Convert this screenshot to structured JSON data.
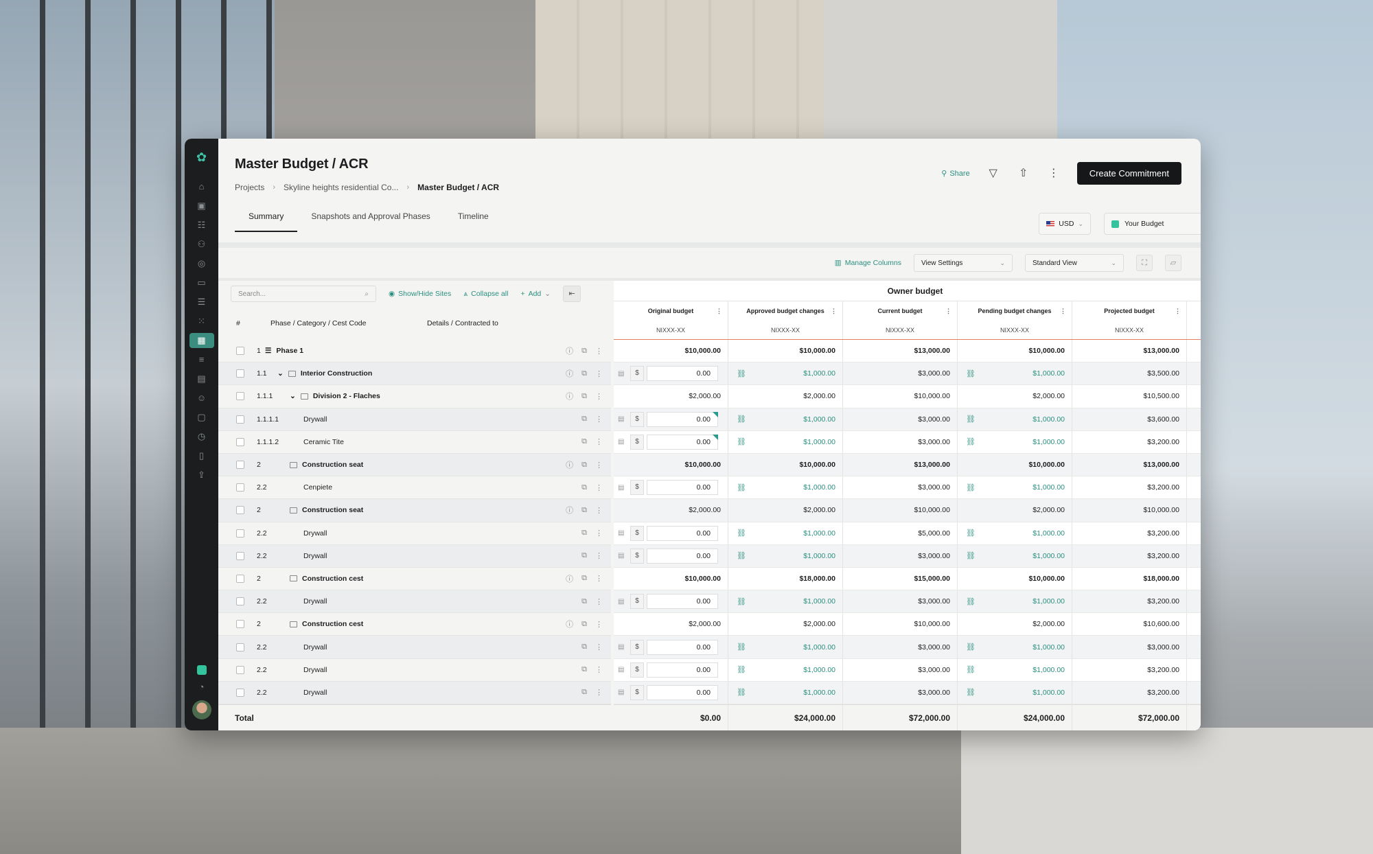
{
  "page_title": "Master Budget / ACR",
  "breadcrumb": [
    "Projects",
    "Skyline heights residential Co...",
    "Master Budget / ACR"
  ],
  "header": {
    "share_label": "Share",
    "create_label": "Create Commitment"
  },
  "tabs": [
    "Summary",
    "Snapshots and Approval Phases",
    "Timeline"
  ],
  "currency": "USD",
  "budget_select": "Your Budget",
  "toolbar": {
    "manage_columns": "Manage Columns",
    "view_settings": "View Settings",
    "standard_view": "Standard View"
  },
  "left_tools": {
    "search_placeholder": "Search...",
    "show_hide": "Show/Hide Sites",
    "collapse_all": "Collapse all",
    "add": "Add"
  },
  "left_headers": {
    "num": "#",
    "phase": "Phase / Category / Cest Code",
    "details": "Details / Contracted to"
  },
  "rows": [
    {
      "num": "1",
      "name": "Phase 1",
      "type": "phase"
    },
    {
      "num": "1.1",
      "name": "Interior Construction",
      "type": "group"
    },
    {
      "num": "1.1.1",
      "name": "Division 2 - Flaches",
      "type": "sub"
    },
    {
      "num": "1.1.1.1",
      "name": "Drywall",
      "type": "item"
    },
    {
      "num": "1.1.1.2",
      "name": "Ceramic Tite",
      "type": "item"
    },
    {
      "num": "2",
      "name": "Construction seat",
      "type": "folder"
    },
    {
      "num": "2.2",
      "name": "Cenpiete",
      "type": "item"
    },
    {
      "num": "2",
      "name": "Construction seat",
      "type": "folder"
    },
    {
      "num": "2.2",
      "name": "Drywall",
      "type": "item"
    },
    {
      "num": "2.2",
      "name": "Drywall",
      "type": "item"
    },
    {
      "num": "2",
      "name": "Construction cest",
      "type": "folder"
    },
    {
      "num": "2.2",
      "name": "Drywall",
      "type": "item"
    },
    {
      "num": "2",
      "name": "Construction cest",
      "type": "folder"
    },
    {
      "num": "2.2",
      "name": "Drywall",
      "type": "item"
    },
    {
      "num": "2.2",
      "name": "Drywall",
      "type": "item"
    },
    {
      "num": "2.2",
      "name": "Drywall",
      "type": "item"
    }
  ],
  "owner_budget": {
    "title": "Owner budget",
    "columns": [
      "Original budget",
      "Approved budget changes",
      "Current budget",
      "Pending budget changes",
      "Projected budget"
    ],
    "codes": [
      "NIXXX-XX",
      "NIXXX-XX",
      "NIXXX-XX",
      "NIXXX-XX",
      "NIXXX-XX"
    ],
    "rows": [
      {
        "orig": "$10,000.00",
        "appr": "$10,000.00",
        "curr": "$13,000.00",
        "pend": "$10,000.00",
        "proj": "$13,000.00",
        "bold": true
      },
      {
        "input": "0.00",
        "appr": "$1,000.00",
        "curr": "$3,000.00",
        "pend": "$1,000.00",
        "proj": "$3,500.00"
      },
      {
        "orig": "$2,000.00",
        "appr": "$2,000.00",
        "curr": "$10,000.00",
        "pend": "$2,000.00",
        "proj": "$10,500.00"
      },
      {
        "input": "0.00",
        "appr": "$1,000.00",
        "curr": "$3,000.00",
        "pend": "$1,000.00",
        "proj": "$3,600.00",
        "flag": true
      },
      {
        "input": "0.00",
        "appr": "$1,000.00",
        "curr": "$3,000.00",
        "pend": "$1,000.00",
        "proj": "$3,200.00",
        "flag": true
      },
      {
        "orig": "$10,000.00",
        "appr": "$10,000.00",
        "curr": "$13,000.00",
        "pend": "$10,000.00",
        "proj": "$13,000.00",
        "bold": true
      },
      {
        "input": "0.00",
        "appr": "$1,000.00",
        "curr": "$3,000.00",
        "pend": "$1,000.00",
        "proj": "$3,200.00"
      },
      {
        "orig": "$2,000.00",
        "appr": "$2,000.00",
        "curr": "$10,000.00",
        "pend": "$2,000.00",
        "proj": "$10,000.00"
      },
      {
        "input": "0.00",
        "appr": "$1,000.00",
        "curr": "$5,000.00",
        "pend": "$1,000.00",
        "proj": "$3,200.00"
      },
      {
        "input": "0.00",
        "appr": "$1,000.00",
        "curr": "$3,000.00",
        "pend": "$1,000.00",
        "proj": "$3,200.00"
      },
      {
        "orig": "$10,000.00",
        "appr": "$18,000.00",
        "curr": "$15,000.00",
        "pend": "$10,000.00",
        "proj": "$18,000.00",
        "bold": true
      },
      {
        "input": "0.00",
        "appr": "$1,000.00",
        "curr": "$3,000.00",
        "pend": "$1,000.00",
        "proj": "$3,200.00"
      },
      {
        "orig": "$2,000.00",
        "appr": "$2,000.00",
        "curr": "$10,000.00",
        "pend": "$2,000.00",
        "proj": "$10,600.00"
      },
      {
        "input": "0.00",
        "appr": "$1,000.00",
        "curr": "$3,000.00",
        "pend": "$1,000.00",
        "proj": "$3,000.00"
      },
      {
        "input": "0.00",
        "appr": "$1,000.00",
        "curr": "$3,000.00",
        "pend": "$1,000.00",
        "proj": "$3,200.00"
      },
      {
        "input": "0.00",
        "appr": "$1,000.00",
        "curr": "$3,000.00",
        "pend": "$1,000.00",
        "proj": "$3,200.00"
      }
    ],
    "totals": [
      "$0.00",
      "$24,000.00",
      "$72,000.00",
      "$24,000.00",
      "$72,000.00"
    ]
  },
  "total_label": "Total",
  "colors": {
    "accent": "#2a8f80",
    "rail": "#1b1d1e",
    "primary_button": "#161718",
    "header_underline": "#e28060"
  }
}
